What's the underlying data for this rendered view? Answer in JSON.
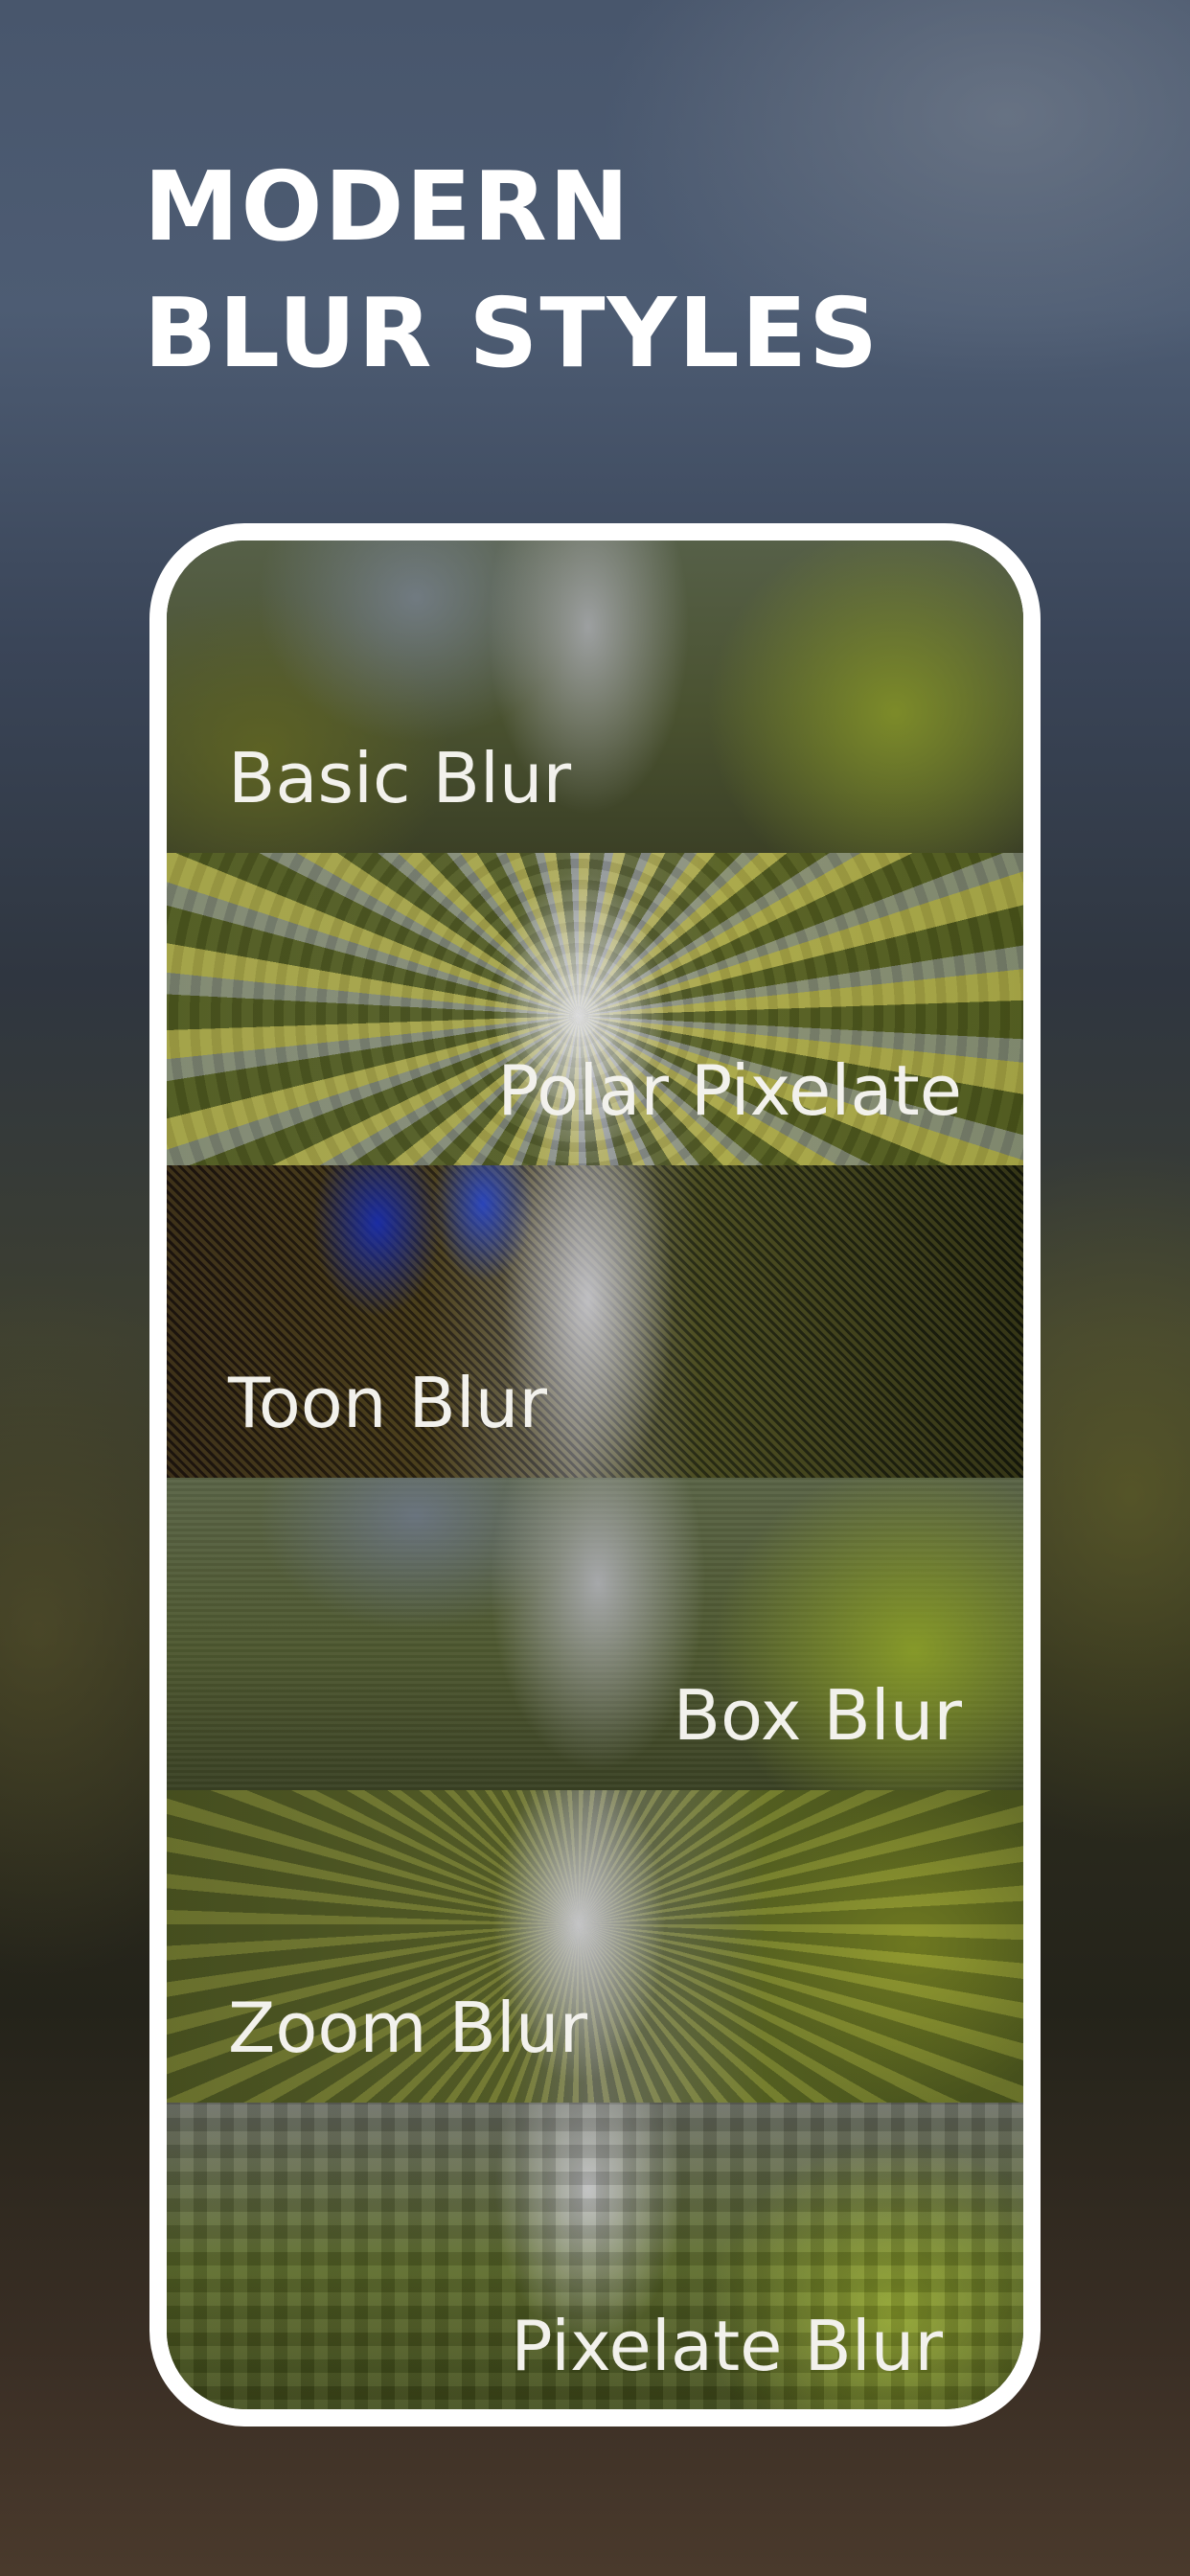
{
  "headline": {
    "line1": "Modern",
    "line2": "Blur Styles"
  },
  "blur_styles": [
    {
      "label": "Basic Blur"
    },
    {
      "label": "Polar Pixelate"
    },
    {
      "label": "Toon Blur"
    },
    {
      "label": "Box Blur"
    },
    {
      "label": "Zoom Blur"
    },
    {
      "label": "Pixelate Blur"
    }
  ]
}
